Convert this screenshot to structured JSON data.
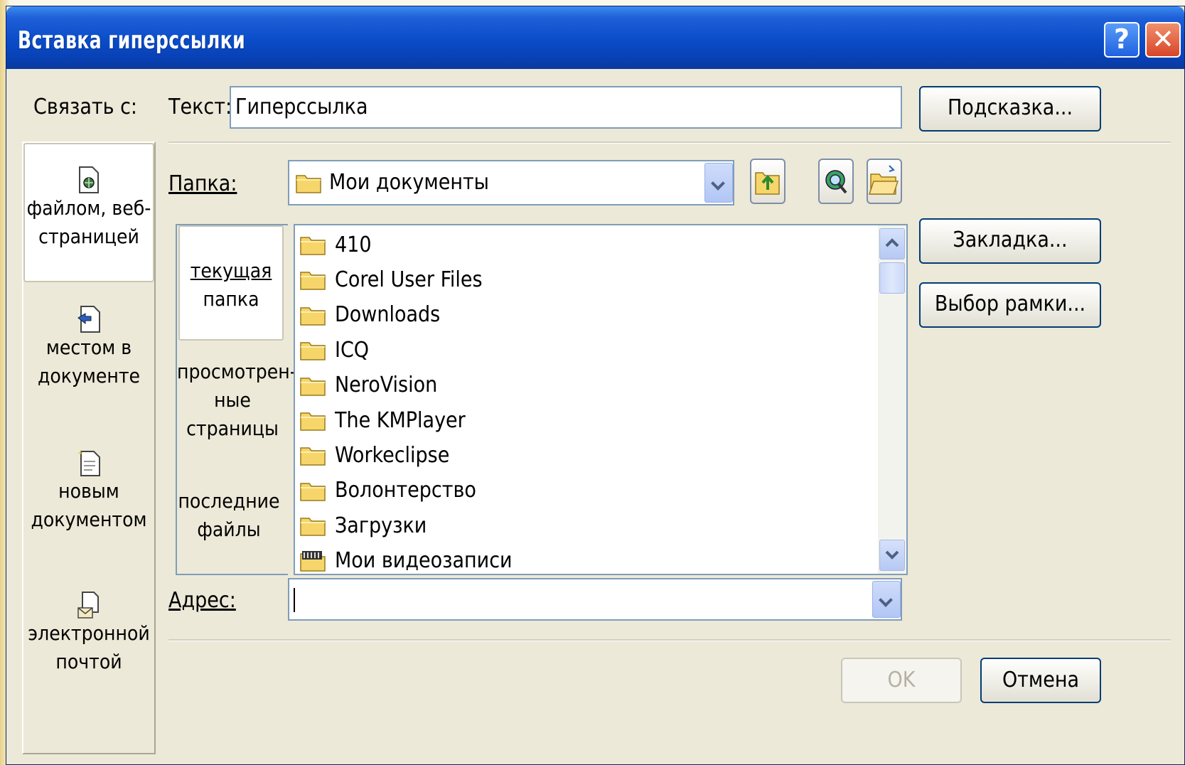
{
  "dialog": {
    "title": "Вставка гиперссылки",
    "help_glyph": "?",
    "close_glyph": "✕"
  },
  "link_to": {
    "label": "Связать с:",
    "items": [
      {
        "line1": "файлом, веб-",
        "line2": "страницей",
        "icon": "file-web-icon",
        "selected": true
      },
      {
        "line1": "местом в",
        "line2": "документе",
        "icon": "place-in-document-icon",
        "selected": false
      },
      {
        "line1": "новым",
        "line2": "документом",
        "icon": "new-document-icon",
        "selected": false
      },
      {
        "line1": "электронной",
        "line2": "почтой",
        "icon": "email-icon",
        "selected": false
      }
    ]
  },
  "text_field": {
    "label": "Текст:",
    "value": "Гиперссылка"
  },
  "buttons": {
    "screen_tip": "Подсказка...",
    "bookmark": "Закладка...",
    "target_frame": "Выбор рамки...",
    "ok": "OK",
    "cancel": "Отмена"
  },
  "folder": {
    "label": "Папка:",
    "value": "Мои документы"
  },
  "places": {
    "current_folder": {
      "line1": "текущая",
      "line2": "папка"
    },
    "browsed_pages": {
      "line1": "просмотрен-",
      "line2": "ные",
      "line3": "страницы"
    },
    "recent_files": {
      "line1": "последние",
      "line2": "файлы"
    }
  },
  "files": [
    {
      "name": "410",
      "icon": "folder-icon"
    },
    {
      "name": "Corel User Files",
      "icon": "folder-icon"
    },
    {
      "name": "Downloads",
      "icon": "folder-icon"
    },
    {
      "name": "ICQ",
      "icon": "folder-icon"
    },
    {
      "name": "NeroVision",
      "icon": "folder-icon"
    },
    {
      "name": "The KMPlayer",
      "icon": "folder-icon"
    },
    {
      "name": "Workeclipse",
      "icon": "folder-icon"
    },
    {
      "name": "Волонтерство",
      "icon": "folder-icon"
    },
    {
      "name": "Загрузки",
      "icon": "folder-icon"
    },
    {
      "name": "Мои видеозаписи",
      "icon": "video-folder-icon"
    }
  ],
  "address": {
    "label": "Адрес:",
    "value": ""
  },
  "colors": {
    "title_bar": "#0a4cc8",
    "dialog_bg": "#ece9d8",
    "button_border": "#003c74"
  }
}
